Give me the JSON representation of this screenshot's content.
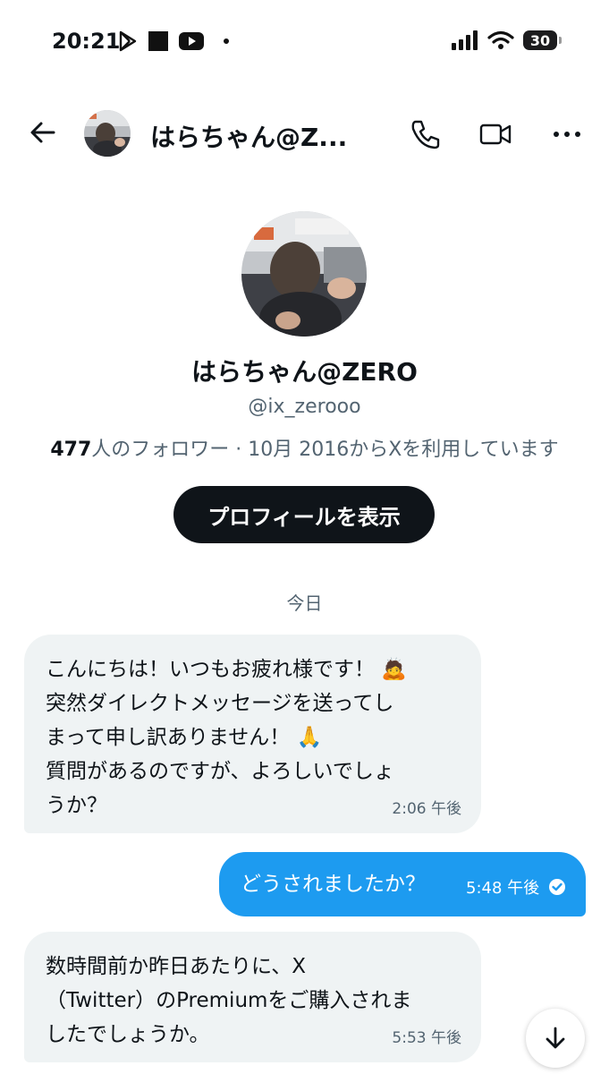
{
  "status_bar": {
    "time": "20:21",
    "battery": "30",
    "icons": [
      "play-store-icon",
      "stop-square-icon",
      "youtube-icon",
      "dot-icon",
      "signal-icon",
      "wifi-icon",
      "battery-icon"
    ]
  },
  "header": {
    "name": "はらちゃん@Z...",
    "icons": [
      "back-arrow-icon",
      "phone-icon",
      "video-icon",
      "more-icon"
    ]
  },
  "profile": {
    "name": "はらちゃん@ZERO",
    "handle": "@ix_zerooo",
    "followers_count": "477",
    "followers_text": "人のフォロワー · 10月 2016からXを利用しています",
    "view_profile_button": "プロフィールを表示"
  },
  "date_separator": "今日",
  "messages": [
    {
      "direction": "in",
      "lines": [
        "こんにちは！いつもお疲れ様です！ 🙇",
        "突然ダイレクトメッセージを送ってし",
        "まって申し訳ありません！ 🙏",
        "質問があるのですが、よろしいでしょ",
        "うか？"
      ],
      "time": "2:06 午後"
    },
    {
      "direction": "out",
      "text": "どうされましたか？",
      "time": "5:48 午後",
      "status": "sent-check"
    },
    {
      "direction": "in",
      "lines": [
        "数時間前か昨日あたりに、X",
        "（Twitter）のPremiumをご購入されま",
        "したでしょうか。"
      ],
      "time": "5:53 午後"
    }
  ],
  "colors": {
    "accent": "#1d9bf0",
    "incoming_bubble": "#eff3f4",
    "text": "#0f1419",
    "muted": "#536471"
  }
}
